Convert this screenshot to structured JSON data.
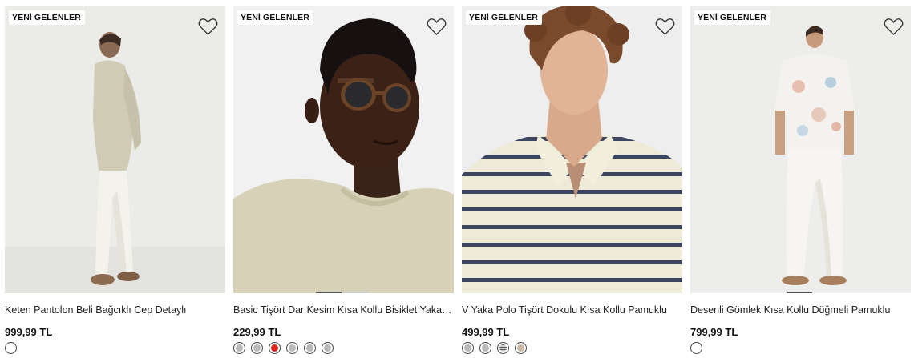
{
  "products": [
    {
      "badge": "YENİ GELENLER",
      "name": "Keten Pantolon Beli Bağcıklı Cep Detaylı",
      "price": "999,99 TL",
      "swatches": [
        "#ffffff"
      ]
    },
    {
      "badge": "YENİ GELENLER",
      "name": "Basic Tişört Dar Kesim Kısa Kollu Bisiklet Yaka Pamuklu",
      "price": "229,99 TL",
      "swatches": [
        "#b9b9b9",
        "#b9b9b9",
        "#d9261c",
        "#b9b9b9",
        "#b9b9b9",
        "#b9b9b9"
      ]
    },
    {
      "badge": "YENİ GELENLER",
      "name": "V Yaka Polo Tişört Dokulu Kısa Kollu Pamuklu",
      "price": "499,99 TL",
      "swatches": [
        "#b9b9b9",
        "#b9b9b9",
        "#cfcfcf",
        "#c9b8a6"
      ]
    },
    {
      "badge": "YENİ GELENLER",
      "name": "Desenli Gömlek Kısa Kollu Düğmeli Pamuklu",
      "price": "799,99 TL",
      "swatches": [
        "#ffffff"
      ]
    }
  ]
}
